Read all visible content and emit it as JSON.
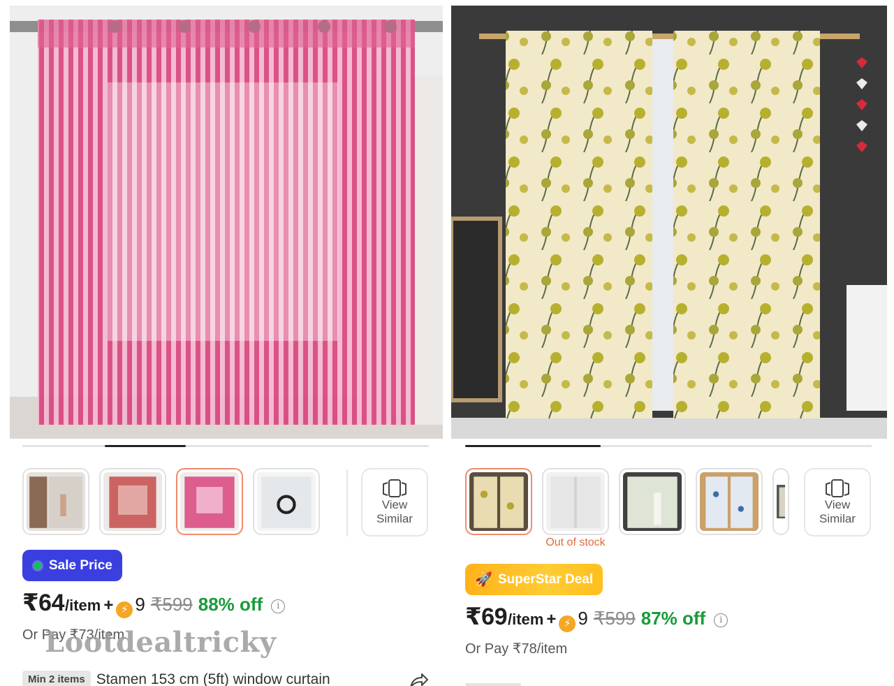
{
  "products": [
    {
      "id_label": "left",
      "progress": 0.2,
      "thumbs": [
        "brown-curtain",
        "red-curtain",
        "pink-curtain",
        "white-curtain"
      ],
      "selected_thumb": 2,
      "view_similar_label": "View\nSimilar",
      "badge": "Sale Price",
      "price": "₹64",
      "unit": "/item",
      "plus": "+",
      "coins": "9",
      "mrp": "₹599",
      "discount": "88% off",
      "or_pay": "Or Pay ₹73/item",
      "min_items": "Min 2 items",
      "title": "Stamen 153 cm (5ft) window curtain"
    },
    {
      "id_label": "right",
      "progress": 0.33,
      "thumbs": [
        "floral-curtain",
        "white-sheer-curtain",
        "green-curtain",
        "blue-pattern-curtain",
        "partial"
      ],
      "selected_thumb": 0,
      "out_of_stock": "Out of stock",
      "view_similar_label": "View\nSimilar",
      "badge": "SuperStar Deal",
      "price": "₹69",
      "unit": "/item",
      "plus": "+",
      "coins": "9",
      "mrp": "₹599",
      "discount": "87% off",
      "or_pay": "Or Pay ₹78/item"
    }
  ],
  "watermark": "Lootdealtricky",
  "colors": {
    "sale_badge": "#3b3fe0",
    "deal_badge": "#ffbf1f",
    "discount": "#1a9b3a",
    "selected_border": "#f08a6b",
    "out_of_stock": "#e06b3e"
  }
}
